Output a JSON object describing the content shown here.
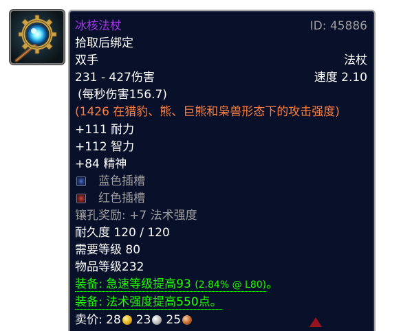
{
  "icon": {
    "name": "frost-staff-icon"
  },
  "item": {
    "name": "冰核法杖",
    "id_label": "ID: 45886",
    "bind": "拾取后绑定",
    "slot": "双手",
    "type": "法杖",
    "damage": "231 - 427伤害",
    "speed": "速度 2.10",
    "dps": "(每秒伤害156.7)",
    "feral_ap": "(1426 在猎豹、熊、巨熊和枭兽形态下的攻击强度)",
    "stats": [
      "+111 耐力",
      "+112 智力",
      "+84 精神"
    ],
    "sockets": [
      {
        "color": "blue",
        "label": "蓝色插槽"
      },
      {
        "color": "red",
        "label": "红色插槽"
      }
    ],
    "socket_bonus": "镶孔奖励: +7 法术强度",
    "durability": "耐久度 120 / 120",
    "required_level": "需要等级 80",
    "item_level": "物品等级232",
    "equip_1": {
      "prefix": "装备: 急速等级提高",
      "value": "93",
      "note": "(2.84% @ L80)",
      "suffix": "。"
    },
    "equip_2": "装备: 法术强度提高550点。",
    "sell": {
      "label": "卖价: ",
      "gold": "28",
      "silver": "23",
      "copper": "25"
    }
  },
  "colors": {
    "epic": "#a335ee",
    "uncommon": "#1eff00",
    "feral": "#ff7f3f",
    "muted": "#9d9d9d",
    "panel_bg": "#08102a"
  }
}
